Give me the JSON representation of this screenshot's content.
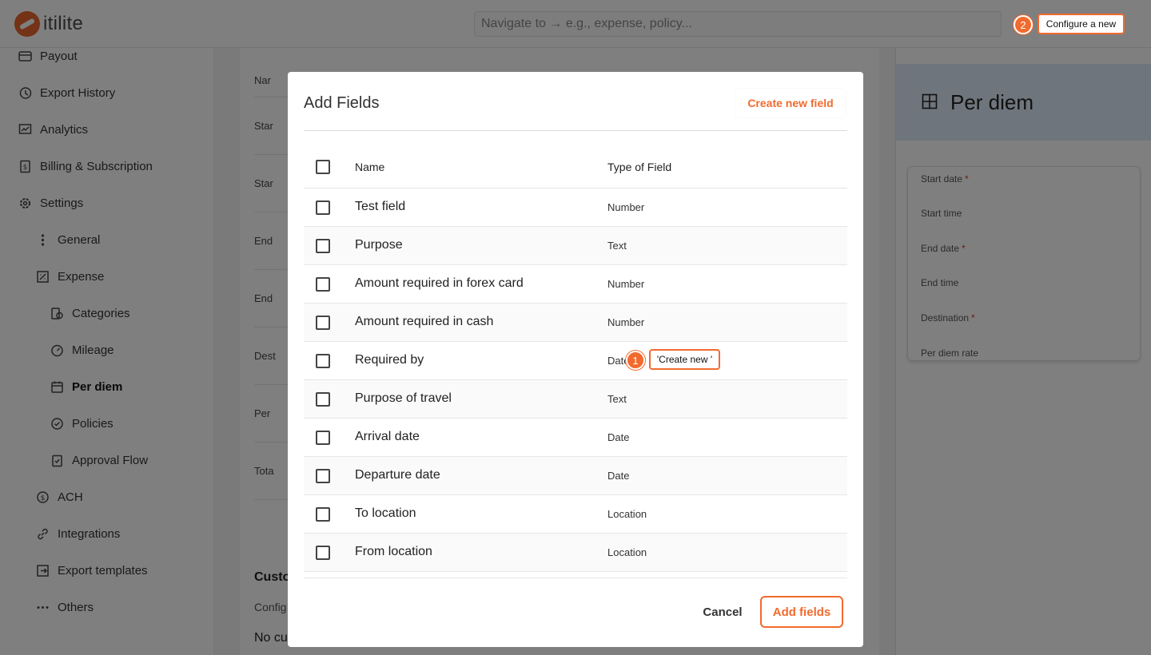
{
  "app": {
    "logo_text": "itilite",
    "search_placeholder": "Navigate to → e.g., expense, policy..."
  },
  "sidebar": {
    "items": [
      {
        "label": "Payout",
        "icon": "card-icon"
      },
      {
        "label": "Export History",
        "icon": "history-icon"
      },
      {
        "label": "Analytics",
        "icon": "chart-icon"
      },
      {
        "label": "Billing & Subscription",
        "icon": "receipt-icon"
      },
      {
        "label": "Settings",
        "icon": "gear-icon"
      },
      {
        "label": "General",
        "icon": "dots-vertical-icon"
      },
      {
        "label": "Expense",
        "icon": "expense-icon"
      },
      {
        "label": "Categories",
        "icon": "categories-icon"
      },
      {
        "label": "Mileage",
        "icon": "speedometer-icon"
      },
      {
        "label": "Per diem",
        "icon": "calendar-icon"
      },
      {
        "label": "Policies",
        "icon": "check-circle-icon"
      },
      {
        "label": "Approval Flow",
        "icon": "clipboard-check-icon"
      },
      {
        "label": "ACH",
        "icon": "dollar-circle-icon"
      },
      {
        "label": "Integrations",
        "icon": "link-icon"
      },
      {
        "label": "Export templates",
        "icon": "export-icon"
      },
      {
        "label": "Others",
        "icon": "dots-horizontal-icon"
      }
    ]
  },
  "background": {
    "col_header": "Nar",
    "rows": [
      "Star",
      "Star",
      "End",
      "End",
      "Dest",
      "Per",
      "Tota"
    ],
    "custom_heading": "Custo",
    "custom_sub": "Config",
    "custom_empty": "No cu"
  },
  "right_panel": {
    "title": "Per diem",
    "fields": [
      {
        "label": "Start date",
        "required": "*"
      },
      {
        "label": "Start time",
        "required": ""
      },
      {
        "label": "End date",
        "required": "*"
      },
      {
        "label": "End time",
        "required": ""
      },
      {
        "label": "Destination",
        "required": "*"
      },
      {
        "label": "Per diem rate",
        "required": ""
      }
    ]
  },
  "modal": {
    "title": "Add Fields",
    "create_link": "Create new field",
    "columns": {
      "name": "Name",
      "type": "Type of Field"
    },
    "rows": [
      {
        "name": "Test field",
        "type": "Number"
      },
      {
        "name": "Purpose",
        "type": "Text"
      },
      {
        "name": "Amount required in forex card",
        "type": "Number"
      },
      {
        "name": "Amount required in cash",
        "type": "Number"
      },
      {
        "name": "Required by",
        "type": "Date"
      },
      {
        "name": "Purpose of travel",
        "type": "Text"
      },
      {
        "name": "Arrival date",
        "type": "Date"
      },
      {
        "name": "Departure date",
        "type": "Date"
      },
      {
        "name": "To location",
        "type": "Location"
      },
      {
        "name": "From location",
        "type": "Location"
      }
    ],
    "cancel_label": "Cancel",
    "add_label": "Add fields"
  },
  "annotations": [
    {
      "number": "1",
      "text": "'Create new '"
    },
    {
      "number": "2",
      "text": "Configure a new"
    }
  ],
  "colors": {
    "accent": "#f26a2e",
    "brand": "#e8642c",
    "panel_header": "#dfeaf8"
  }
}
